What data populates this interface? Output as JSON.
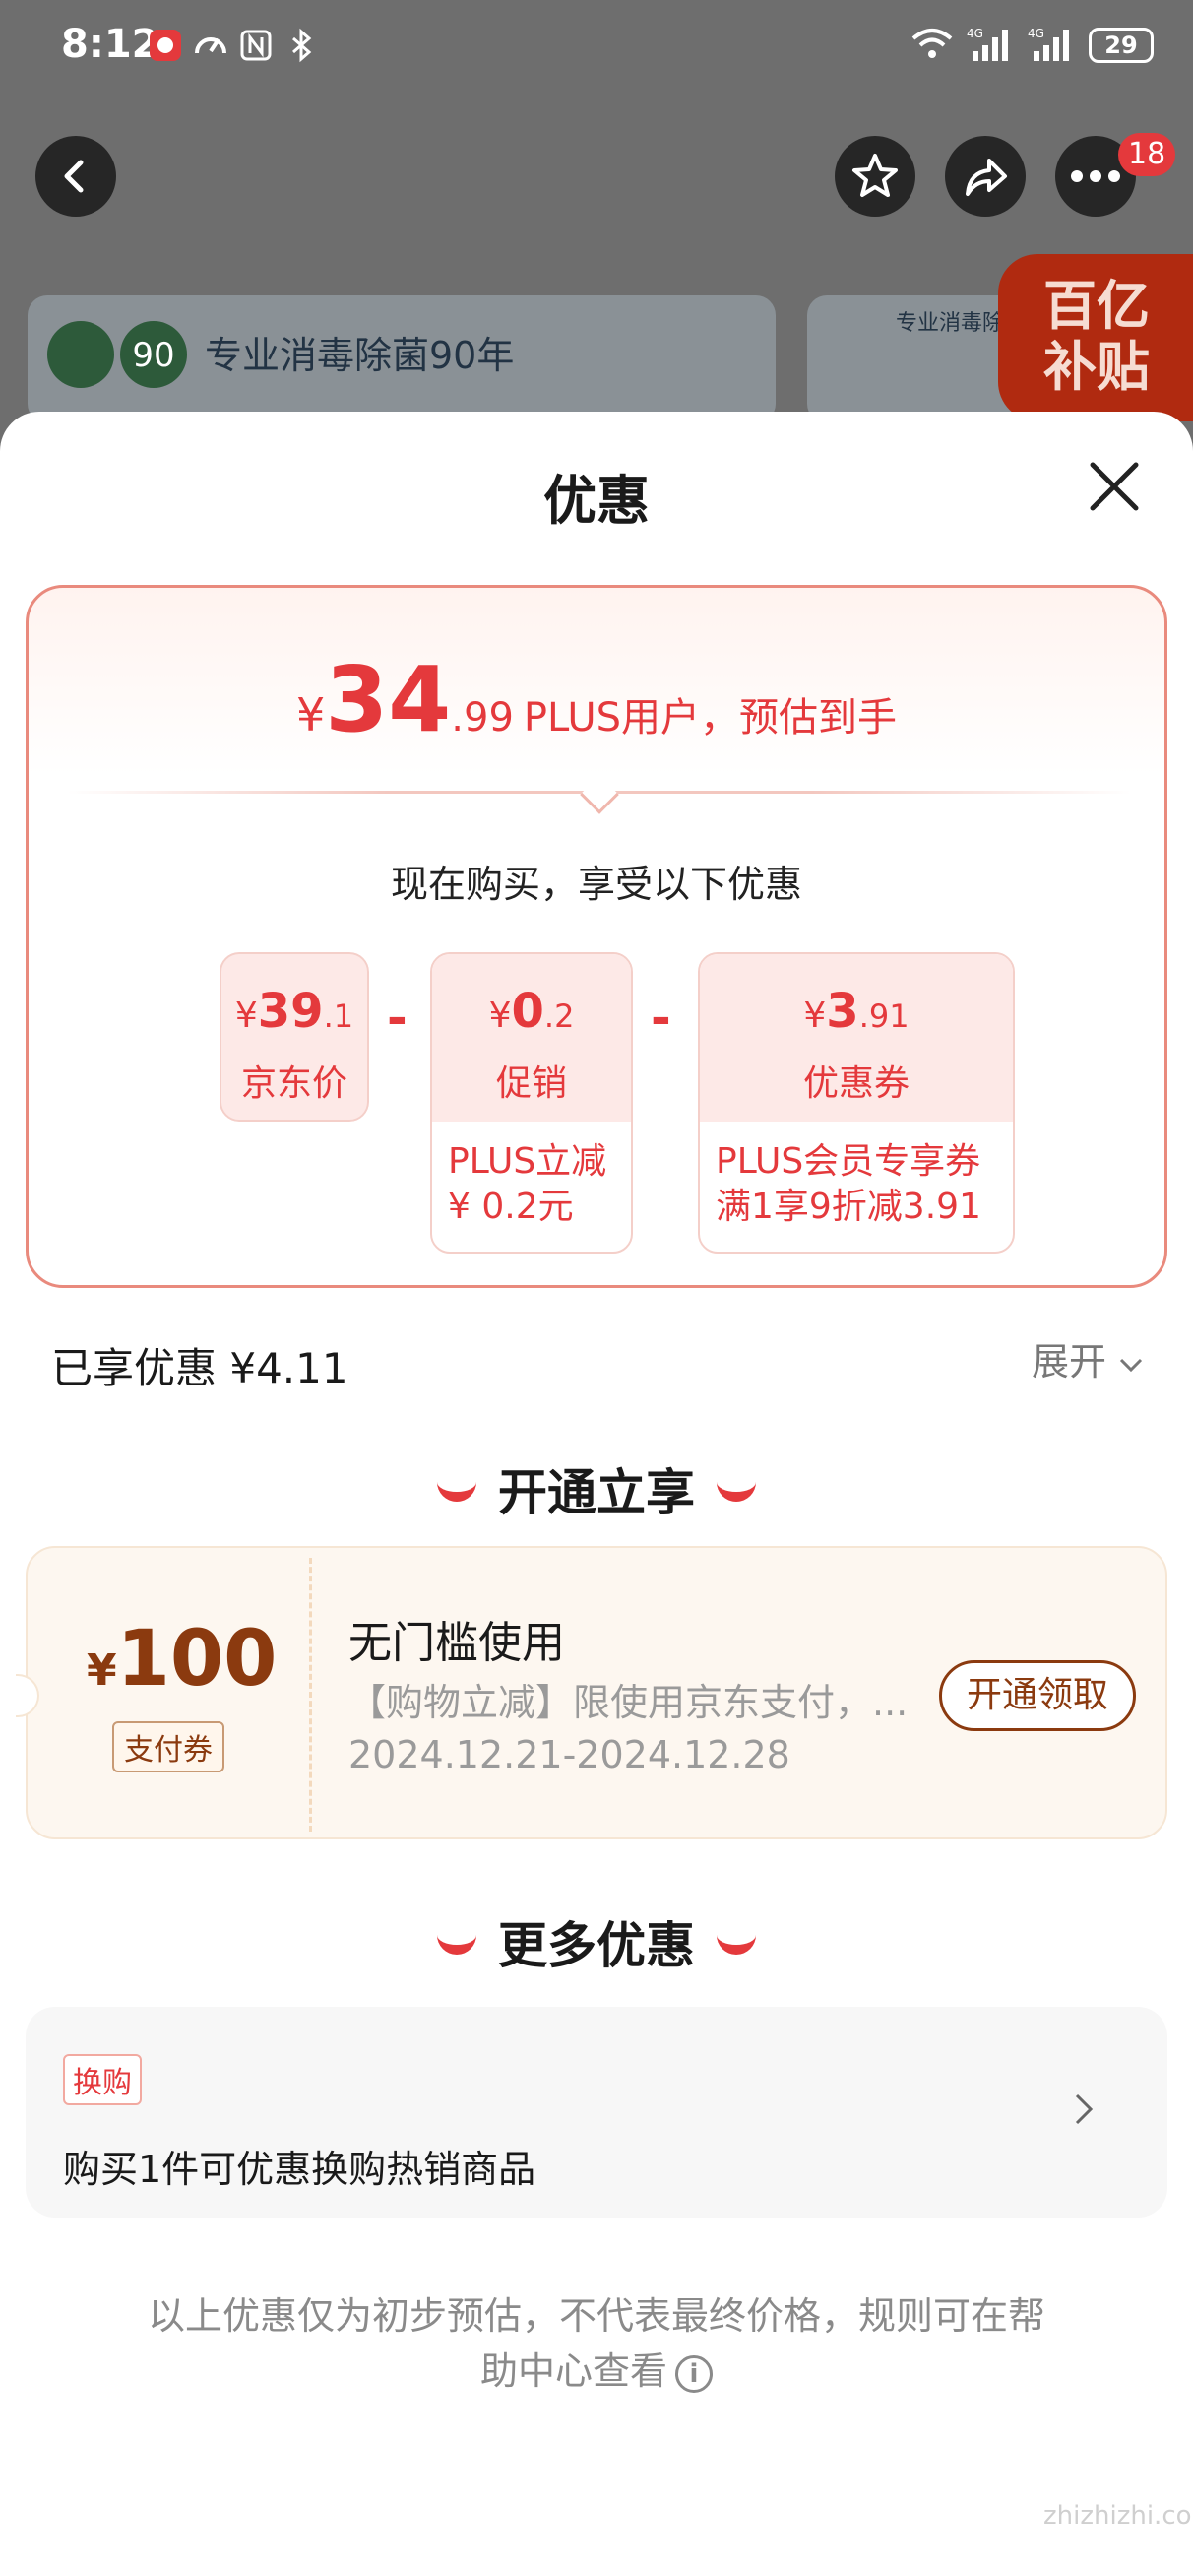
{
  "status_bar": {
    "time": "8:12",
    "battery": "29",
    "network": "4G"
  },
  "nav": {
    "cart_badge": "18"
  },
  "background": {
    "banner_text": "专业消毒除菌90年",
    "banner_small_text": "专业消毒除菌",
    "subsidy_line1": "百亿",
    "subsidy_line2": "补贴"
  },
  "sheet": {
    "title": "优惠"
  },
  "price_card": {
    "currency": "¥",
    "price_int": "34",
    "price_dec": ".99",
    "price_desc": "PLUS用户，预估到手",
    "buy_now": "现在购买，享受以下优惠",
    "items": [
      {
        "amount_int": "39",
        "amount_dec": ".1",
        "label": "京东价"
      },
      {
        "amount_int": "0",
        "amount_dec": ".2",
        "label": "促销",
        "detail_1": "PLUS立减",
        "detail_2": "¥ 0.2元"
      },
      {
        "amount_int": "3",
        "amount_dec": ".91",
        "label": "优惠券",
        "detail_1": "PLUS会员专享券",
        "detail_2": "满1享9折减3.91"
      }
    ],
    "minus": "-"
  },
  "enjoyed": {
    "label": "已享优惠 ¥4.11",
    "expand": "展开"
  },
  "section_open": {
    "title": "开通立享"
  },
  "coupon": {
    "currency": "¥",
    "amount": "100",
    "tag": "支付券",
    "title": "无门槛使用",
    "desc": "【购物立减】限使用京东支付，...",
    "date": "2024.12.21-2024.12.28",
    "button": "开通领取"
  },
  "section_more": {
    "title": "更多优惠"
  },
  "more": {
    "tag": "换购",
    "text": "购买1件可优惠换购热销商品"
  },
  "footnote": {
    "line1": "以上优惠仅为初步预估，不代表最终价格，规则可在帮",
    "line2": "助中心查看"
  },
  "watermark": "zhizhizhi.com",
  "colors": {
    "accent": "#e4393c",
    "coupon_brown": "#8b3a0f"
  }
}
